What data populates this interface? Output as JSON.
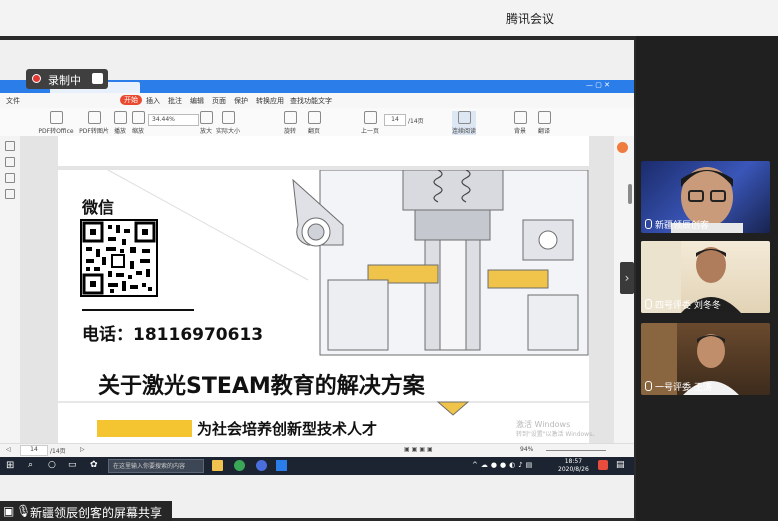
{
  "meeting": {
    "title": "腾讯会议",
    "recording_label": "录制中",
    "share_label": "新疆领辰创客的屏幕共享"
  },
  "participants": [
    {
      "name": "新疆领辰创客"
    },
    {
      "name": "四号评委  刘冬冬"
    },
    {
      "name": "一号评委  王涛"
    }
  ],
  "pdf_app": {
    "menu": [
      "文件",
      "开始",
      "插入",
      "批注",
      "编辑",
      "页面",
      "保护",
      "转换应用",
      "查找功能文字"
    ],
    "active_menu": "开始",
    "toolbar": [
      "PDF转Office",
      "PDF转图片",
      "播放",
      "缩放",
      "放大",
      "实际大小",
      "旋转",
      "翻页",
      "上一页",
      "连续阅读",
      "背景",
      "翻译"
    ],
    "zoom": "34.44%",
    "page_current": "14",
    "page_total": "/14页",
    "status_page": "14",
    "status_total": "/14页",
    "status_zoom": "94%"
  },
  "slide": {
    "wechat_label": "微信",
    "phone": "电话：18116970613",
    "title": "关于激光STEAM教育的解决方案",
    "subtitle": "为社会培养创新型技术人才"
  },
  "watermark": {
    "line1": "激活 Windows",
    "line2": "转到\"设置\"以激活 Windows。"
  },
  "taskbar": {
    "search_placeholder": "在这里输入你要搜索的内容",
    "time": "18:57",
    "date": "2020/8/26"
  }
}
